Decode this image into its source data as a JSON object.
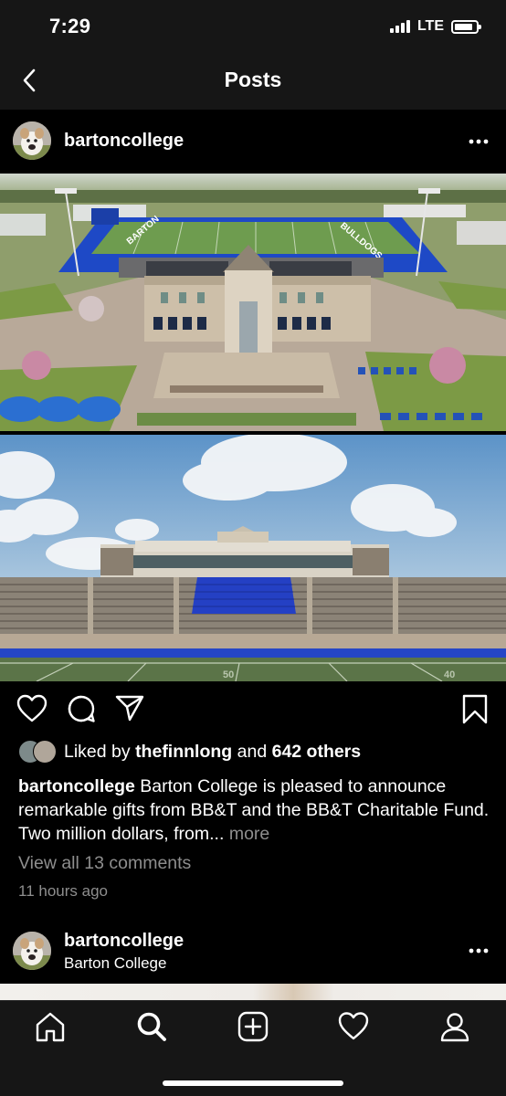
{
  "status_bar": {
    "time": "7:29",
    "network": "LTE",
    "battery_level": 0.85
  },
  "header": {
    "title": "Posts"
  },
  "post": {
    "username": "bartoncollege",
    "likes": {
      "prefix": "Liked by",
      "user": "thefinnlong",
      "conjunction": "and",
      "others": "642 others"
    },
    "caption": {
      "username": "bartoncollege",
      "text": "Barton College is pleased to announce remarkable gifts from BB&T and the BB&T Charitable Fund. Two million dollars, from...",
      "more": "more"
    },
    "comments_link": "View all 13 comments",
    "time": "11 hours ago",
    "images": {
      "field_name": "BARTON",
      "endzone_name": "BULLDOGS",
      "yard_marker_left": "50",
      "yard_marker_right": "40"
    }
  },
  "next_post": {
    "username": "bartoncollege",
    "location": "Barton College"
  },
  "colors": {
    "background": "#000000",
    "bar": "#161616",
    "secondary_text": "#8e8e8e",
    "turf_blue": "#1e49c6"
  },
  "tab_bar": {
    "items": [
      "home-icon",
      "search-icon",
      "new-post-icon",
      "activity-heart-icon",
      "profile-icon"
    ],
    "active": "search-icon"
  }
}
